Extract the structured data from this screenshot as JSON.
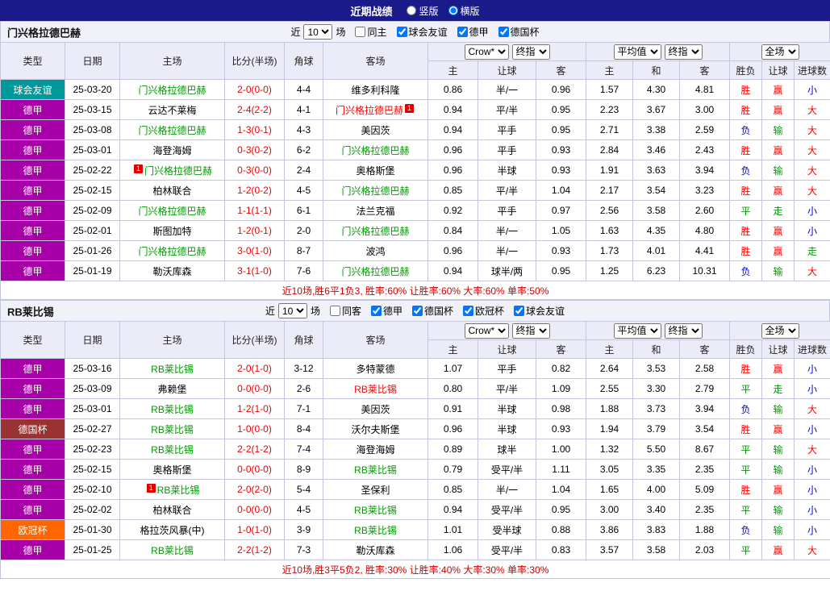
{
  "top_bar": {
    "title": "近期战绩",
    "layout_options": [
      {
        "label": "竖版",
        "selected": false
      },
      {
        "label": "横版",
        "selected": true
      }
    ]
  },
  "table_headers": {
    "type": "类型",
    "date": "日期",
    "home": "主场",
    "score": "比分(半场)",
    "corner": "角球",
    "away": "客场",
    "odds_company": "Crow*",
    "avg_company": "平均值",
    "final_label": "终指",
    "full_label": "全场",
    "sub": [
      "主",
      "让球",
      "客",
      "主",
      "和",
      "客",
      "胜负",
      "让球",
      "进球数"
    ]
  },
  "filter_labels": {
    "prefix": "近",
    "suffix": "场"
  },
  "badge_char": "1",
  "type_colors": {
    "球会友谊": "#00999B",
    "德甲": "#A800A8",
    "德国杯": "#993333",
    "欧冠杯": "#FF6600"
  },
  "team_colors": {
    "green": "#009900",
    "red": "#FF0000",
    "black": "#000000"
  },
  "result_colors": {
    "胜": "#FF0000",
    "负": "#0000E0",
    "平": "#009900",
    "赢": "#FF0000",
    "输": "#009900",
    "走": "#009900",
    "大": "#FF0000",
    "小": "#0000E0"
  },
  "sections": [
    {
      "team": "门兴格拉德巴赫",
      "filter": {
        "count": "10",
        "checkboxes": [
          {
            "label": "同主",
            "checked": false
          },
          {
            "label": "球会友谊",
            "checked": true
          },
          {
            "label": "德甲",
            "checked": true
          },
          {
            "label": "德国杯",
            "checked": true
          }
        ]
      },
      "rows": [
        {
          "type": "球会友谊",
          "date": "25-03-20",
          "home": {
            "name": "门兴格拉德巴赫",
            "color": "green"
          },
          "score": "2-0(0-0)",
          "corner": "4-4",
          "away": {
            "name": "维多利科隆",
            "color": "black"
          },
          "odds": [
            "0.86",
            "半/一",
            "0.96"
          ],
          "avg": [
            "1.57",
            "4.30",
            "4.81"
          ],
          "results": [
            "胜",
            "赢",
            "小"
          ]
        },
        {
          "type": "德甲",
          "date": "25-03-15",
          "home": {
            "name": "云达不莱梅",
            "color": "black"
          },
          "score": "2-4(2-2)",
          "corner": "4-1",
          "away": {
            "name": "门兴格拉德巴赫",
            "color": "red",
            "badge": "end"
          },
          "odds": [
            "0.94",
            "平/半",
            "0.95"
          ],
          "avg": [
            "2.23",
            "3.67",
            "3.00"
          ],
          "results": [
            "胜",
            "赢",
            "大"
          ]
        },
        {
          "type": "德甲",
          "date": "25-03-08",
          "home": {
            "name": "门兴格拉德巴赫",
            "color": "green"
          },
          "score": "1-3(0-1)",
          "corner": "4-3",
          "away": {
            "name": "美因茨",
            "color": "black"
          },
          "odds": [
            "0.94",
            "平手",
            "0.95"
          ],
          "avg": [
            "2.71",
            "3.38",
            "2.59"
          ],
          "results": [
            "负",
            "输",
            "大"
          ]
        },
        {
          "type": "德甲",
          "date": "25-03-01",
          "home": {
            "name": "海登海姆",
            "color": "black"
          },
          "score": "0-3(0-2)",
          "corner": "6-2",
          "away": {
            "name": "门兴格拉德巴赫",
            "color": "green"
          },
          "odds": [
            "0.96",
            "平手",
            "0.93"
          ],
          "avg": [
            "2.84",
            "3.46",
            "2.43"
          ],
          "results": [
            "胜",
            "赢",
            "大"
          ]
        },
        {
          "type": "德甲",
          "date": "25-02-22",
          "home": {
            "name": "门兴格拉德巴赫",
            "color": "green",
            "badge": "start"
          },
          "score": "0-3(0-0)",
          "corner": "2-4",
          "away": {
            "name": "奥格斯堡",
            "color": "black"
          },
          "odds": [
            "0.96",
            "半球",
            "0.93"
          ],
          "avg": [
            "1.91",
            "3.63",
            "3.94"
          ],
          "results": [
            "负",
            "输",
            "大"
          ]
        },
        {
          "type": "德甲",
          "date": "25-02-15",
          "home": {
            "name": "柏林联合",
            "color": "black"
          },
          "score": "1-2(0-2)",
          "corner": "4-5",
          "away": {
            "name": "门兴格拉德巴赫",
            "color": "green"
          },
          "odds": [
            "0.85",
            "平/半",
            "1.04"
          ],
          "avg": [
            "2.17",
            "3.54",
            "3.23"
          ],
          "results": [
            "胜",
            "赢",
            "大"
          ]
        },
        {
          "type": "德甲",
          "date": "25-02-09",
          "home": {
            "name": "门兴格拉德巴赫",
            "color": "green"
          },
          "score": "1-1(1-1)",
          "corner": "6-1",
          "away": {
            "name": "法兰克福",
            "color": "black"
          },
          "odds": [
            "0.92",
            "平手",
            "0.97"
          ],
          "avg": [
            "2.56",
            "3.58",
            "2.60"
          ],
          "results": [
            "平",
            "走",
            "小"
          ]
        },
        {
          "type": "德甲",
          "date": "25-02-01",
          "home": {
            "name": "斯图加特",
            "color": "black"
          },
          "score": "1-2(0-1)",
          "corner": "2-0",
          "away": {
            "name": "门兴格拉德巴赫",
            "color": "green"
          },
          "odds": [
            "0.84",
            "半/一",
            "1.05"
          ],
          "avg": [
            "1.63",
            "4.35",
            "4.80"
          ],
          "results": [
            "胜",
            "赢",
            "小"
          ]
        },
        {
          "type": "德甲",
          "date": "25-01-26",
          "home": {
            "name": "门兴格拉德巴赫",
            "color": "green"
          },
          "score": "3-0(1-0)",
          "corner": "8-7",
          "away": {
            "name": "波鸿",
            "color": "black"
          },
          "odds": [
            "0.96",
            "半/一",
            "0.93"
          ],
          "avg": [
            "1.73",
            "4.01",
            "4.41"
          ],
          "results": [
            "胜",
            "赢",
            "走"
          ]
        },
        {
          "type": "德甲",
          "date": "25-01-19",
          "home": {
            "name": "勒沃库森",
            "color": "black"
          },
          "score": "3-1(1-0)",
          "corner": "7-6",
          "away": {
            "name": "门兴格拉德巴赫",
            "color": "green"
          },
          "odds": [
            "0.94",
            "球半/两",
            "0.95"
          ],
          "avg": [
            "1.25",
            "6.23",
            "10.31"
          ],
          "results": [
            "负",
            "输",
            "大"
          ]
        }
      ],
      "summary": "近10场,胜6平1负3, 胜率:60% 让胜率:60% 大率:60% 单率:50%"
    },
    {
      "team": "RB莱比锡",
      "filter": {
        "count": "10",
        "checkboxes": [
          {
            "label": "同客",
            "checked": false
          },
          {
            "label": "德甲",
            "checked": true
          },
          {
            "label": "德国杯",
            "checked": true
          },
          {
            "label": "欧冠杯",
            "checked": true
          },
          {
            "label": "球会友谊",
            "checked": true
          }
        ]
      },
      "rows": [
        {
          "type": "德甲",
          "date": "25-03-16",
          "home": {
            "name": "RB莱比锡",
            "color": "green"
          },
          "score": "2-0(1-0)",
          "corner": "3-12",
          "away": {
            "name": "多特蒙德",
            "color": "black"
          },
          "odds": [
            "1.07",
            "平手",
            "0.82"
          ],
          "avg": [
            "2.64",
            "3.53",
            "2.58"
          ],
          "results": [
            "胜",
            "赢",
            "小"
          ]
        },
        {
          "type": "德甲",
          "date": "25-03-09",
          "home": {
            "name": "弗赖堡",
            "color": "black"
          },
          "score": "0-0(0-0)",
          "corner": "2-6",
          "away": {
            "name": "RB莱比锡",
            "color": "red"
          },
          "odds": [
            "0.80",
            "平/半",
            "1.09"
          ],
          "avg": [
            "2.55",
            "3.30",
            "2.79"
          ],
          "results": [
            "平",
            "走",
            "小"
          ]
        },
        {
          "type": "德甲",
          "date": "25-03-01",
          "home": {
            "name": "RB莱比锡",
            "color": "green"
          },
          "score": "1-2(1-0)",
          "corner": "7-1",
          "away": {
            "name": "美因茨",
            "color": "black"
          },
          "odds": [
            "0.91",
            "半球",
            "0.98"
          ],
          "avg": [
            "1.88",
            "3.73",
            "3.94"
          ],
          "results": [
            "负",
            "输",
            "大"
          ]
        },
        {
          "type": "德国杯",
          "date": "25-02-27",
          "home": {
            "name": "RB莱比锡",
            "color": "green"
          },
          "score": "1-0(0-0)",
          "corner": "8-4",
          "away": {
            "name": "沃尔夫斯堡",
            "color": "black"
          },
          "odds": [
            "0.96",
            "半球",
            "0.93"
          ],
          "avg": [
            "1.94",
            "3.79",
            "3.54"
          ],
          "results": [
            "胜",
            "赢",
            "小"
          ]
        },
        {
          "type": "德甲",
          "date": "25-02-23",
          "home": {
            "name": "RB莱比锡",
            "color": "green"
          },
          "score": "2-2(1-2)",
          "corner": "7-4",
          "away": {
            "name": "海登海姆",
            "color": "black"
          },
          "odds": [
            "0.89",
            "球半",
            "1.00"
          ],
          "avg": [
            "1.32",
            "5.50",
            "8.67"
          ],
          "results": [
            "平",
            "输",
            "大"
          ]
        },
        {
          "type": "德甲",
          "date": "25-02-15",
          "home": {
            "name": "奥格斯堡",
            "color": "black"
          },
          "score": "0-0(0-0)",
          "corner": "8-9",
          "away": {
            "name": "RB莱比锡",
            "color": "green"
          },
          "odds": [
            "0.79",
            "受平/半",
            "1.11"
          ],
          "avg": [
            "3.05",
            "3.35",
            "2.35"
          ],
          "results": [
            "平",
            "输",
            "小"
          ]
        },
        {
          "type": "德甲",
          "date": "25-02-10",
          "home": {
            "name": "RB莱比锡",
            "color": "green",
            "badge": "start"
          },
          "score": "2-0(2-0)",
          "corner": "5-4",
          "away": {
            "name": "圣保利",
            "color": "black"
          },
          "odds": [
            "0.85",
            "半/一",
            "1.04"
          ],
          "avg": [
            "1.65",
            "4.00",
            "5.09"
          ],
          "results": [
            "胜",
            "赢",
            "小"
          ]
        },
        {
          "type": "德甲",
          "date": "25-02-02",
          "home": {
            "name": "柏林联合",
            "color": "black"
          },
          "score": "0-0(0-0)",
          "corner": "4-5",
          "away": {
            "name": "RB莱比锡",
            "color": "green"
          },
          "odds": [
            "0.94",
            "受平/半",
            "0.95"
          ],
          "avg": [
            "3.00",
            "3.40",
            "2.35"
          ],
          "results": [
            "平",
            "输",
            "小"
          ]
        },
        {
          "type": "欧冠杯",
          "date": "25-01-30",
          "home": {
            "name": "格拉茨风暴(中)",
            "color": "black"
          },
          "score": "1-0(1-0)",
          "corner": "3-9",
          "away": {
            "name": "RB莱比锡",
            "color": "green"
          },
          "odds": [
            "1.01",
            "受半球",
            "0.88"
          ],
          "avg": [
            "3.86",
            "3.83",
            "1.88"
          ],
          "results": [
            "负",
            "输",
            "小"
          ]
        },
        {
          "type": "德甲",
          "date": "25-01-25",
          "home": {
            "name": "RB莱比锡",
            "color": "green"
          },
          "score": "2-2(1-2)",
          "corner": "7-3",
          "away": {
            "name": "勒沃库森",
            "color": "black"
          },
          "odds": [
            "1.06",
            "受平/半",
            "0.83"
          ],
          "avg": [
            "3.57",
            "3.58",
            "2.03"
          ],
          "results": [
            "平",
            "赢",
            "大"
          ]
        }
      ],
      "summary": "近10场,胜3平5负2, 胜率:30% 让胜率:40% 大率:30% 单率:30%"
    }
  ]
}
